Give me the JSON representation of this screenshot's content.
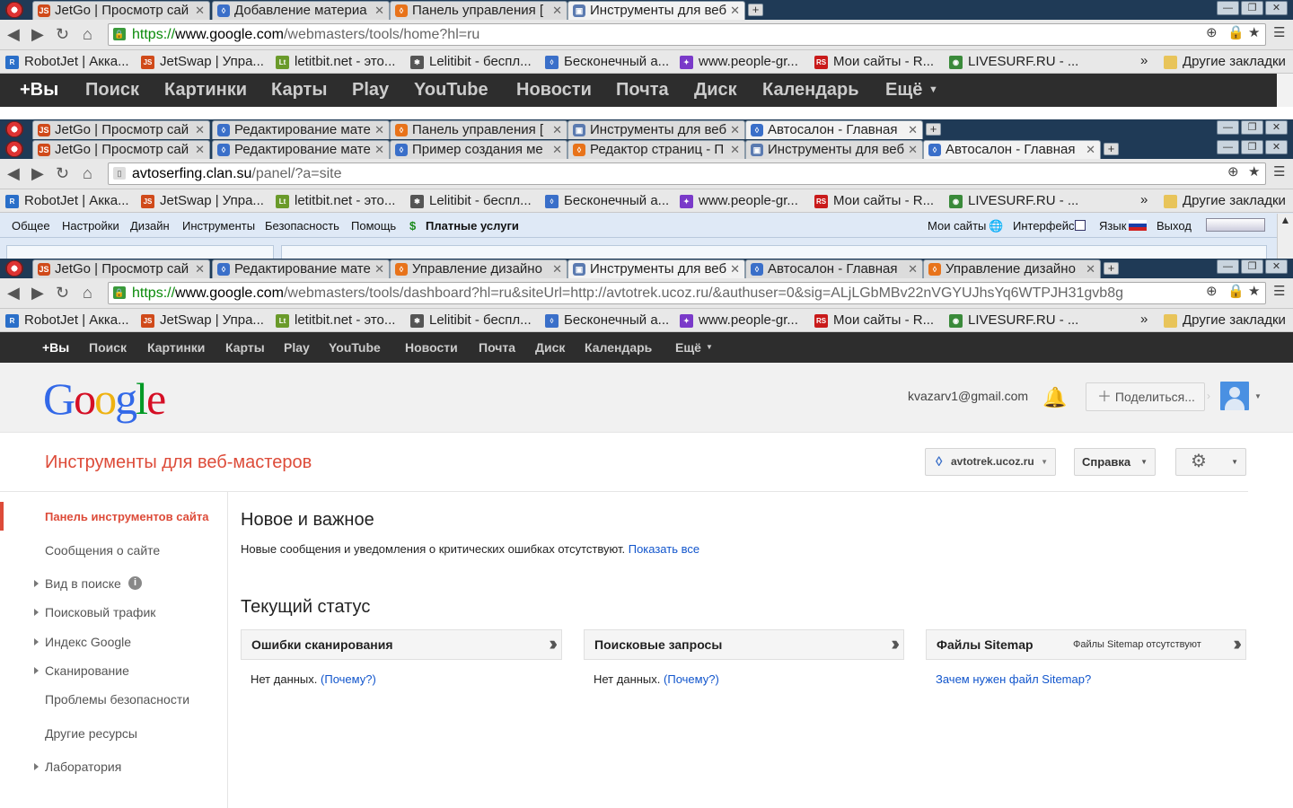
{
  "window1": {
    "tabs": [
      {
        "label": "JetGo | Просмотр сай",
        "icon": "jetswap-icon"
      },
      {
        "label": "Добавление материа",
        "icon": "ucoz-icon"
      },
      {
        "label": "Панель управления [",
        "icon": "ucoz-orange-icon"
      },
      {
        "label": "Инструменты для веб",
        "icon": "webmaster-tools-icon"
      }
    ],
    "url": {
      "scheme": "https://",
      "host": "www.google.com",
      "path": "/webmasters/tools/home?hl=ru"
    },
    "gbar": [
      "+Вы",
      "Поиск",
      "Картинки",
      "Карты",
      "Play",
      "YouTube",
      "Новости",
      "Почта",
      "Диск",
      "Календарь",
      "Ещё"
    ]
  },
  "window2": {
    "tabs": [
      {
        "label": "JetGo | Просмотр сай"
      },
      {
        "label": "Редактирование мате"
      },
      {
        "label": "Панель управления ["
      },
      {
        "label": "Инструменты для веб"
      },
      {
        "label": "Автосалон - Главная"
      }
    ]
  },
  "window3": {
    "tabs": [
      {
        "label": "JetGo | Просмотр сай"
      },
      {
        "label": "Редактирование мате"
      },
      {
        "label": "Пример создания ме"
      },
      {
        "label": "Редактор страниц - П"
      },
      {
        "label": "Инструменты для веб"
      },
      {
        "label": "Автосалон - Главная"
      }
    ],
    "url": {
      "host": "avtoserfing.clan.su",
      "path": "/panel/?a=site"
    },
    "ucoz_menu": [
      "Общее",
      "Настройки",
      "Дизайн",
      "Инструменты",
      "Безопасность",
      "Помощь"
    ],
    "ucoz_paid": "Платные услуги",
    "ucoz_right": [
      "Мои сайты",
      "Интерфейс",
      "Язык",
      "Выход"
    ]
  },
  "window4": {
    "tabs": [
      {
        "label": "JetGo | Просмотр сай"
      },
      {
        "label": "Редактирование мате"
      },
      {
        "label": "Управление дизайно"
      },
      {
        "label": "Инструменты для веб"
      },
      {
        "label": "Автосалон - Главная"
      },
      {
        "label": "Управление дизайно"
      }
    ],
    "url": {
      "scheme": "https://",
      "host": "www.google.com",
      "path": "/webmasters/tools/dashboard?hl=ru&siteUrl=http://avtotrek.ucoz.ru/&authuser=0&sig=ALjLGbMBv22nVGYUJhsYq6WTPJH31gvb8g"
    },
    "gbar": [
      "+Вы",
      "Поиск",
      "Картинки",
      "Карты",
      "Play",
      "YouTube",
      "Новости",
      "Почта",
      "Диск",
      "Календарь",
      "Ещё"
    ]
  },
  "bookmarks": [
    {
      "label": "RobotJet | Акка...",
      "color": "#2a6fc9"
    },
    {
      "label": "JetSwap | Упра...",
      "color": "#d04a1a"
    },
    {
      "label": "letitbit.net - это...",
      "color": "#6a9a2a"
    },
    {
      "label": "Lelitibit - беспл...",
      "color": "#555555"
    },
    {
      "label": "Бесконечный а...",
      "color": "#3a6fc9"
    },
    {
      "label": "www.people-gr...",
      "color": "#7a3ac9"
    },
    {
      "label": "Мои сайты - R...",
      "color": "#c91a1a"
    },
    {
      "label": "LIVESURF.RU - ...",
      "color": "#3a8a3a"
    }
  ],
  "bookmarks_overflow": "»",
  "other_bookmarks": "Другие закладки",
  "header": {
    "logo": "Google",
    "email": "kvazarv1@gmail.com",
    "share": "Поделиться..."
  },
  "product_title": "Инструменты для веб-мастеров",
  "site_selector": "avtotrek.ucoz.ru",
  "help_label": "Справка",
  "sidebar": [
    {
      "label": "Панель инструментов сайта",
      "active": true,
      "expandable": false
    },
    {
      "label": "Сообщения о сайте",
      "active": false,
      "expandable": false
    },
    {
      "label": "Вид в поиске",
      "active": false,
      "expandable": true
    },
    {
      "label": "Поисковый трафик",
      "active": false,
      "expandable": true
    },
    {
      "label": "Индекс Google",
      "active": false,
      "expandable": true
    },
    {
      "label": "Сканирование",
      "active": false,
      "expandable": true
    },
    {
      "label": "Проблемы безопасности",
      "active": false,
      "expandable": false
    },
    {
      "label": "Другие ресурсы",
      "active": false,
      "expandable": false
    },
    {
      "label": "Лаборатория",
      "active": false,
      "expandable": true
    }
  ],
  "new_important": {
    "title": "Новое и важное",
    "text": "Новые сообщения и уведомления о критических ошибках отсутствуют.",
    "link": "Показать все"
  },
  "status": {
    "title": "Текущий статус",
    "cards": [
      {
        "title": "Ошибки сканирования",
        "note": "",
        "body": "Нет данных.",
        "link": "(Почему?)"
      },
      {
        "title": "Поисковые запросы",
        "note": "",
        "body": "Нет данных.",
        "link": "(Почему?)"
      },
      {
        "title": "Файлы Sitemap",
        "note": "Файлы Sitemap отсутствуют",
        "body": "",
        "link": "Зачем нужен файл Sitemap?"
      }
    ]
  },
  "colors": {
    "accent_red": "#dd4b39",
    "link_blue": "#1155cc",
    "gbar_bg": "#2d2d2d",
    "tabrow_bg": "#1f3a56"
  }
}
